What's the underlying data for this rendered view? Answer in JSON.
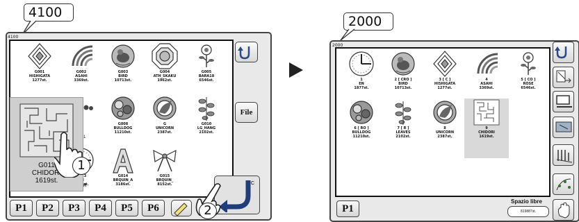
{
  "left": {
    "callout": "4100",
    "memory": "4100",
    "items": [
      {
        "label": "G001\nHISHIGATA\n1277st.",
        "icon": "diamond"
      },
      {
        "label": "G002\nASAHI\n3369st.",
        "icon": "sunrays"
      },
      {
        "label": "G003\nBIRD\n10713st.",
        "icon": "bird"
      },
      {
        "label": "G004\nATH_SKAKU\n1962st.",
        "icon": "octagon"
      },
      {
        "label": "G005\nBARA18\n6546st.",
        "icon": "rose"
      },
      {
        "label": "",
        "icon": "black-block"
      },
      {
        "label": "",
        "icon": "dots"
      },
      {
        "label": "G008\nBULLDOG\n11210st.",
        "icon": "floral"
      },
      {
        "label": "G\nUNICORN\n2387st.",
        "icon": "unicorn"
      },
      {
        "label": "G010\nLG_HANG\n2102st.",
        "icon": "leaves"
      },
      {
        "label": "",
        "icon": "none"
      },
      {
        "label": "G013\nEN\n1877st.",
        "icon": "clock"
      },
      {
        "label": "G014\nBRQUIN_A\n3186st.",
        "icon": "letter-a"
      },
      {
        "label": "G015\nBRQUIN_\n8152st.",
        "icon": "bow"
      }
    ],
    "magnified": {
      "code": "G011",
      "name": "CHIDORI",
      "stitches": "1619st."
    },
    "partial_labels": [
      "1",
      "R"
    ],
    "pages": [
      "P1",
      "P2",
      "P3",
      "P4",
      "P5",
      "P6"
    ],
    "file_button": "File",
    "markers": [
      "1",
      "2"
    ]
  },
  "right": {
    "callout": "2000",
    "memory": "2000",
    "items": [
      {
        "label": "1\nEN\n1877st.",
        "icon": "clock"
      },
      {
        "label": "2 [ CRO ]\nBIRD\n10713st.",
        "icon": "bird"
      },
      {
        "label": "3 [ C ]\nHISHIGATA\n1277st.",
        "icon": "diamond"
      },
      {
        "label": "4\nASAHI\n3369st.",
        "icon": "sunrays"
      },
      {
        "label": "5 [ CO ]\nROSE\n6546st.",
        "icon": "rose"
      },
      {
        "label": "6 [ RO ]\nBULLDOG\n11210st.",
        "icon": "floral"
      },
      {
        "label": "7 [ R ]\nLEAVES\n2102st.",
        "icon": "leaves"
      },
      {
        "label": "8\nUNICORN\n2387st.",
        "icon": "unicorn"
      },
      {
        "label": "9\nCHIDORI\n1619st.",
        "icon": "maze"
      }
    ],
    "pages": [
      "P1"
    ],
    "free_space_label": "Spazio libre",
    "free_space_value": "819887st."
  }
}
